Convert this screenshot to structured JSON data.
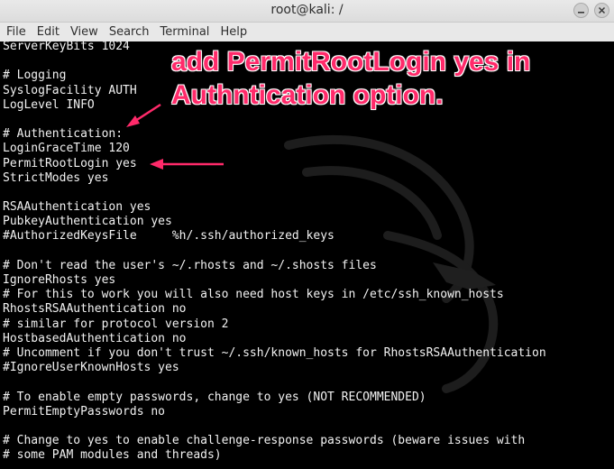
{
  "window": {
    "title": "root@kali: /"
  },
  "menu": [
    {
      "label": "File"
    },
    {
      "label": "Edit"
    },
    {
      "label": "View"
    },
    {
      "label": "Search"
    },
    {
      "label": "Terminal"
    },
    {
      "label": "Help"
    }
  ],
  "terminal": {
    "lines": [
      "ServerKeyBits 1024",
      "",
      "# Logging",
      "SyslogFacility AUTH",
      "LogLevel INFO",
      "",
      "# Authentication:",
      "LoginGraceTime 120",
      "PermitRootLogin yes",
      "StrictModes yes",
      "",
      "RSAAuthentication yes",
      "PubkeyAuthentication yes",
      "#AuthorizedKeysFile     %h/.ssh/authorized_keys",
      "",
      "# Don't read the user's ~/.rhosts and ~/.shosts files",
      "IgnoreRhosts yes",
      "# For this to work you will also need host keys in /etc/ssh_known_hosts",
      "RhostsRSAAuthentication no",
      "# similar for protocol version 2",
      "HostbasedAuthentication no",
      "# Uncomment if you don't trust ~/.ssh/known_hosts for RhostsRSAAuthentication",
      "#IgnoreUserKnownHosts yes",
      "",
      "# To enable empty passwords, change to yes (NOT RECOMMENDED)",
      "PermitEmptyPasswords no",
      "",
      "# Change to yes to enable challenge-response passwords (beware issues with",
      "# some PAM modules and threads)"
    ]
  },
  "annotation": {
    "line1": "add PermitRootLogin yes in",
    "line2": "Authntication option.",
    "color": "#ff2a6a"
  },
  "icons": {
    "minimize": "minimize-icon",
    "close": "close-icon",
    "background": "kali-dragon-icon"
  }
}
